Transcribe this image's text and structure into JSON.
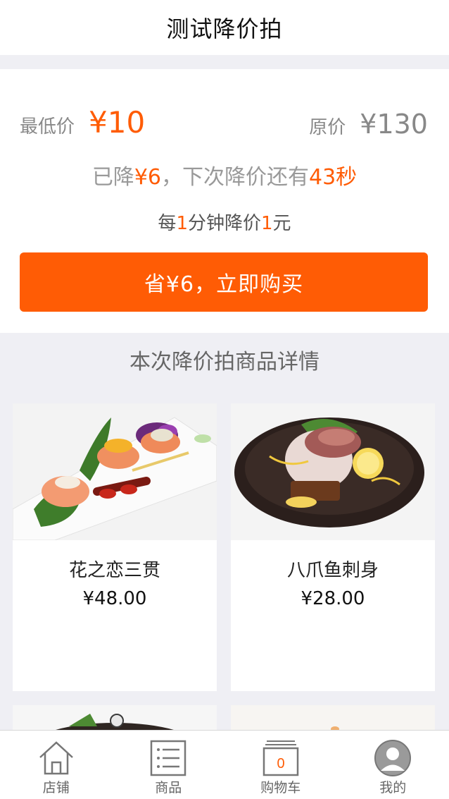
{
  "header": {
    "title": "测试降价拍"
  },
  "pricing": {
    "lowest_label": "最低价",
    "lowest_value": "¥10",
    "original_label": "原价",
    "original_value": "¥130",
    "dropped_prefix": "已降",
    "dropped_amount": "¥6",
    "next_drop_text": "，下次降价还有",
    "countdown": "43秒",
    "rule_prefix": "每",
    "rule_minutes": "1",
    "rule_middle": "分钟降价",
    "rule_amount": "1",
    "rule_suffix": "元",
    "buy_button": "省¥6，立即购买"
  },
  "section": {
    "title": "本次降价拍商品详情"
  },
  "products": [
    {
      "name": "花之恋三贯",
      "price": "¥48.00"
    },
    {
      "name": "八爪鱼刺身",
      "price": "¥28.00"
    }
  ],
  "tabbar": {
    "items": [
      {
        "label": "店铺",
        "icon": "home-icon"
      },
      {
        "label": "商品",
        "icon": "list-icon"
      },
      {
        "label": "购物车",
        "icon": "cart-icon",
        "badge": "0"
      },
      {
        "label": "我的",
        "icon": "user-icon"
      }
    ]
  },
  "colors": {
    "accent": "#ff5c05"
  }
}
